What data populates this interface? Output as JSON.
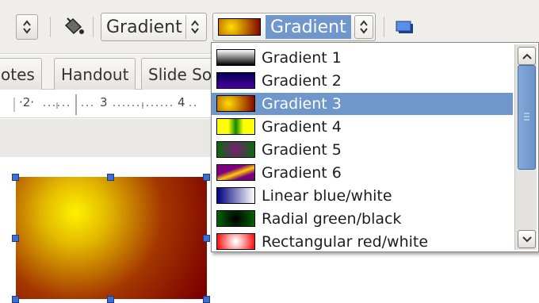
{
  "toolbar": {
    "area_style_label": "Gradient",
    "fill_label": "Gradient",
    "selected_fill_swatch": "Gradient 3"
  },
  "tabs": [
    {
      "label": "otes"
    },
    {
      "label": "Handout"
    },
    {
      "label": "Slide So"
    }
  ],
  "ruler": {
    "ticks": [
      "·2·",
      "3",
      "4"
    ]
  },
  "dropdown": {
    "items": [
      {
        "label": "Gradient 1",
        "swatch": "linear-gradient(#ffffff,#000000)"
      },
      {
        "label": "Gradient 2",
        "swatch": "linear-gradient(#000055,#4a00a0)"
      },
      {
        "label": "Gradient 3",
        "swatch": "radial-gradient(circle at 30% 50%, #ffdd00, #800000)"
      },
      {
        "label": "Gradient 4",
        "swatch": "linear-gradient(90deg,#ffff00 0%,#ffff00 30%,#0b8a00 50%,#ffff00 70%,#ffff00 100%)"
      },
      {
        "label": "Gradient 5",
        "swatch": "radial-gradient(circle, #7a1a7a, #007000)"
      },
      {
        "label": "Gradient 6",
        "swatch": "linear-gradient(160deg,#7f007f 0%,#7f007f 35%,#ffcc00 55%,#7f007f 75%)"
      },
      {
        "label": "Linear blue/white",
        "swatch": "linear-gradient(90deg,#00007f,#ffffff)"
      },
      {
        "label": "Radial green/black",
        "swatch": "radial-gradient(circle, #000000, #006b00)"
      },
      {
        "label": "Rectangular red/white",
        "swatch": "radial-gradient(circle, #ffffff 5%, #ff0000)"
      }
    ],
    "selected_index": 2
  }
}
